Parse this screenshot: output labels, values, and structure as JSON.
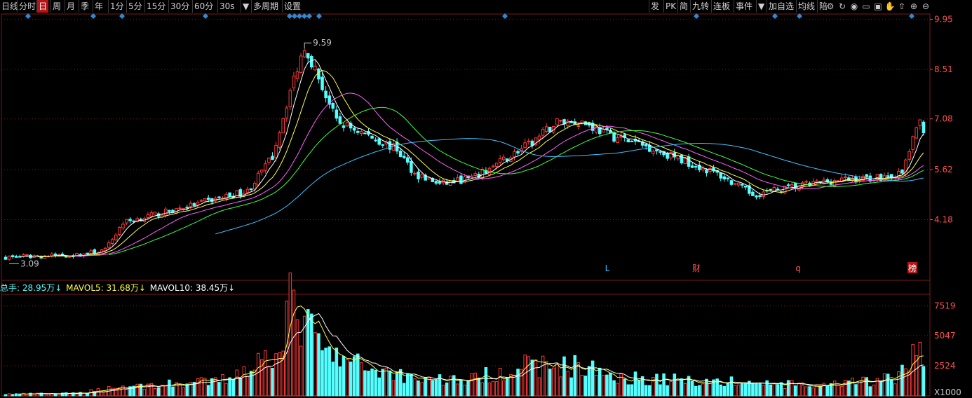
{
  "toolbar": {
    "left_items": [
      "日线",
      "分时",
      "日",
      "周",
      "月",
      "季",
      "年",
      "1分",
      "5分",
      "15分",
      "30分",
      "60分",
      "30s",
      "▼",
      "多周期",
      "设置"
    ],
    "active": "日",
    "right_items": [
      "发",
      "PK",
      "简",
      "九转",
      "连板",
      "事件",
      "▼",
      "加自选",
      "均线",
      "陪"
    ]
  },
  "price_axis": {
    "labels": [
      "9.95",
      "8.51",
      "7.08",
      "5.62",
      "4.18"
    ]
  },
  "volume_axis": {
    "labels": [
      "7519",
      "5047",
      "2524",
      "X1000"
    ]
  },
  "annotations": {
    "high": "9.59",
    "low": "3.09"
  },
  "event_markers": [
    {
      "text": "L",
      "color": "#40c0ff"
    },
    {
      "text": "财",
      "color": "#ff5050"
    },
    {
      "text": "q",
      "color": "#ff5050"
    },
    {
      "text": "榜",
      "color": "#ffffff",
      "bg": "#b41414"
    }
  ],
  "volume_legend": {
    "total": "总手: 28.95万↓",
    "mavol5": "MAVOL5: 31.68万↓",
    "mavol10": "MAVOL10: 38.45万↓"
  },
  "colors": {
    "up": "#ff3a3a",
    "down": "#54ffff",
    "ma5": "#ffffff",
    "ma10": "#ffff40",
    "ma20": "#ff60ff",
    "ma30": "#40ff40",
    "ma60": "#40c0ff",
    "grid": "#7a1a1a",
    "marker": "#2a8cd8"
  },
  "chart_data": {
    "type": "candlestick",
    "price_range": [
      3.0,
      10.1
    ],
    "volume_range": [
      0,
      8500
    ],
    "volume_unit": "X1000",
    "anchors": [
      [
        0,
        3.1
      ],
      [
        12,
        3.14
      ],
      [
        20,
        3.16
      ],
      [
        28,
        3.3
      ],
      [
        33,
        4.1
      ],
      [
        45,
        4.4
      ],
      [
        60,
        4.8
      ],
      [
        68,
        5.0
      ],
      [
        75,
        6.0
      ],
      [
        80,
        7.9
      ],
      [
        84,
        9.2
      ],
      [
        87,
        8.5
      ],
      [
        93,
        7.0
      ],
      [
        100,
        6.7
      ],
      [
        110,
        6.2
      ],
      [
        115,
        5.5
      ],
      [
        122,
        5.2
      ],
      [
        132,
        5.4
      ],
      [
        140,
        5.9
      ],
      [
        148,
        6.4
      ],
      [
        155,
        7.0
      ],
      [
        162,
        7.0
      ],
      [
        170,
        6.6
      ],
      [
        180,
        6.3
      ],
      [
        190,
        5.9
      ],
      [
        200,
        5.5
      ],
      [
        210,
        4.9
      ],
      [
        220,
        5.1
      ],
      [
        232,
        5.3
      ],
      [
        245,
        5.4
      ],
      [
        252,
        5.5
      ],
      [
        254,
        6.2
      ],
      [
        257,
        7.0
      ],
      [
        258,
        6.8
      ]
    ],
    "volume_anchors": [
      [
        0,
        150
      ],
      [
        20,
        200
      ],
      [
        30,
        700
      ],
      [
        60,
        1200
      ],
      [
        75,
        3500
      ],
      [
        80,
        7500
      ],
      [
        84,
        6000
      ],
      [
        90,
        3500
      ],
      [
        100,
        2500
      ],
      [
        115,
        1500
      ],
      [
        130,
        1300
      ],
      [
        145,
        2500
      ],
      [
        160,
        2500
      ],
      [
        175,
        1500
      ],
      [
        200,
        1200
      ],
      [
        230,
        800
      ],
      [
        250,
        1500
      ],
      [
        254,
        2500
      ],
      [
        257,
        4500
      ],
      [
        258,
        4100
      ]
    ],
    "count": 259
  }
}
